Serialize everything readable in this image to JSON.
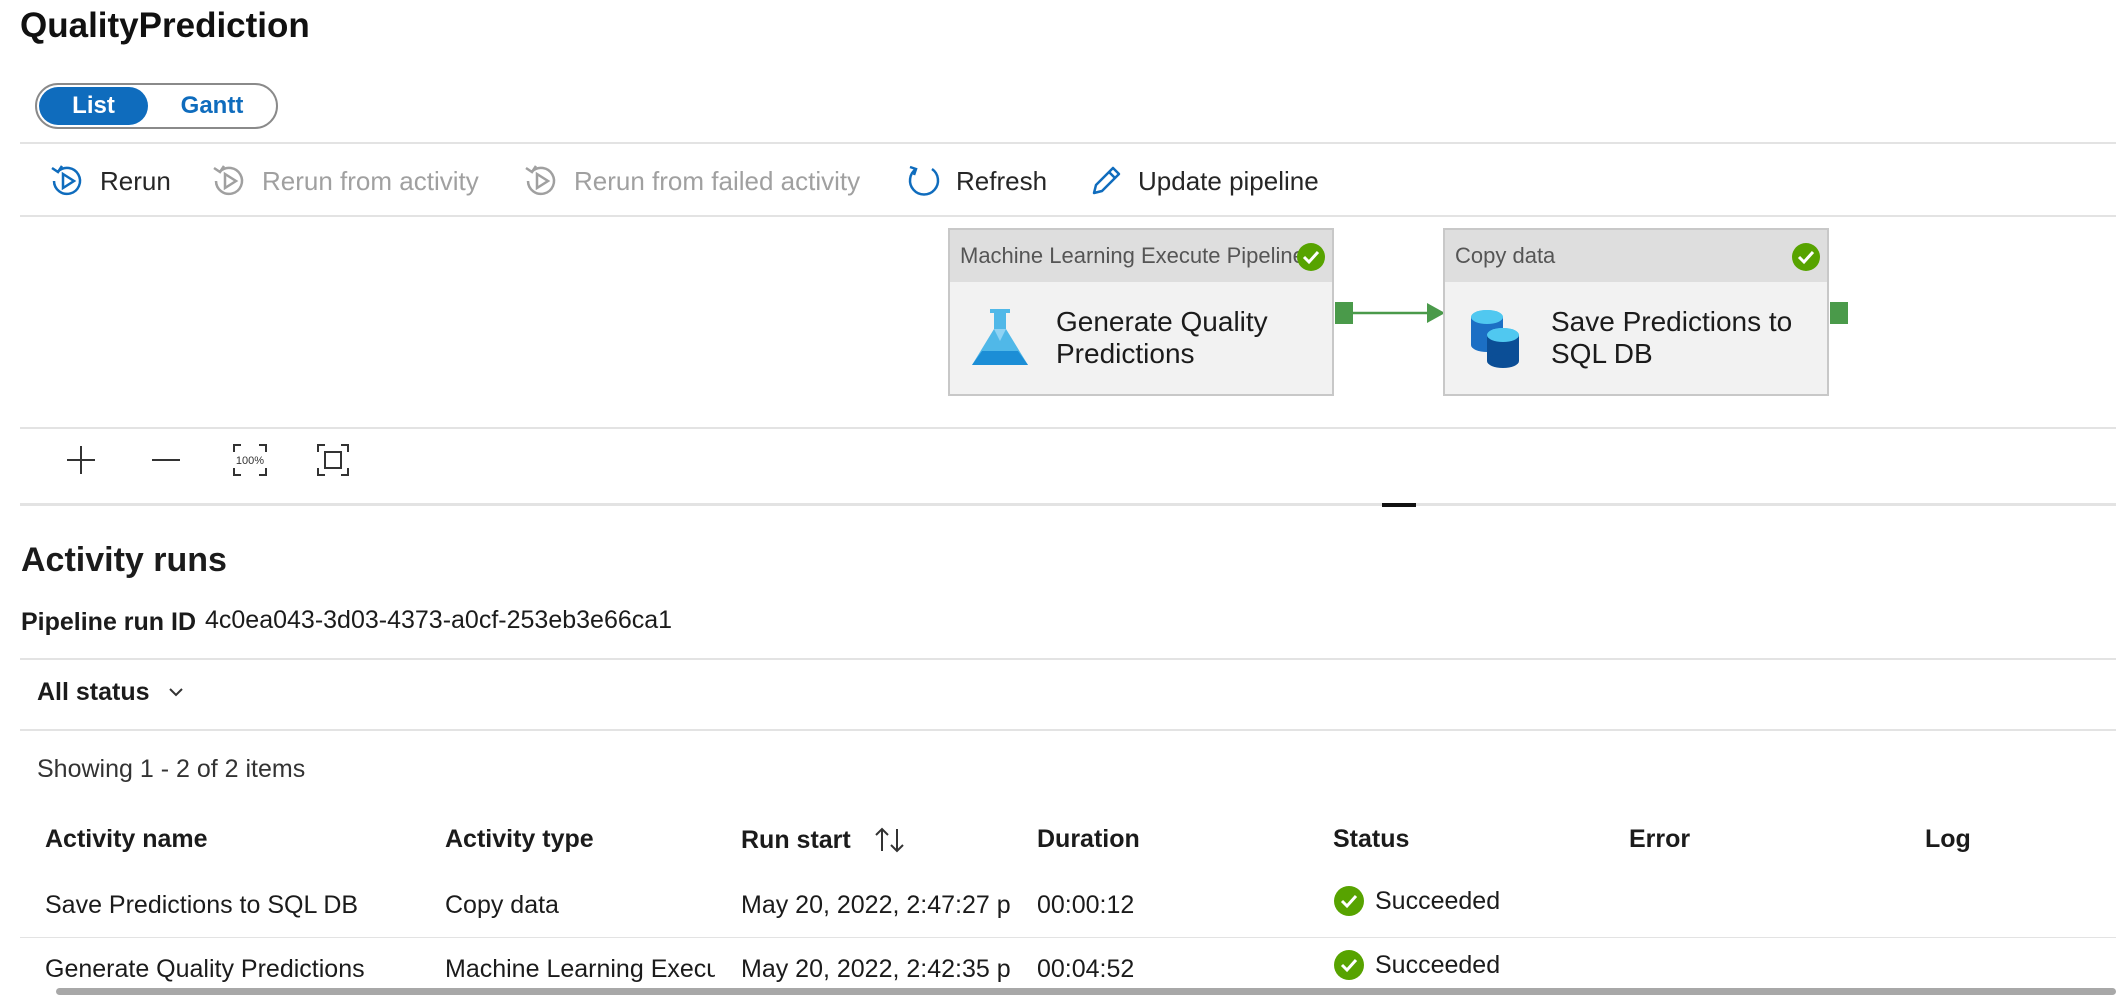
{
  "page_title": "QualityPrediction",
  "view_toggle": {
    "list_label": "List",
    "gantt_label": "Gantt",
    "selected": "List"
  },
  "toolbar": {
    "rerun": "Rerun",
    "rerun_from_activity": "Rerun from activity",
    "rerun_from_failed": "Rerun from failed activity",
    "refresh": "Refresh",
    "update_pipeline": "Update pipeline"
  },
  "canvas": {
    "nodes": [
      {
        "type_label": "Machine Learning Execute Pipeline",
        "name_line1": "Generate Quality",
        "name_line2": "Predictions",
        "icon": "flask-icon",
        "status": "succeeded"
      },
      {
        "type_label": "Copy data",
        "name_line1": "Save Predictions to",
        "name_line2": "SQL DB",
        "icon": "database-icon",
        "status": "succeeded"
      }
    ],
    "zoom_100_label": "100%"
  },
  "activity_runs": {
    "title": "Activity runs",
    "pipeline_run_id_label": "Pipeline run ID",
    "pipeline_run_id": "4c0ea043-3d03-4373-a0cf-253eb3e66ca1",
    "status_filter": "All status",
    "showing": "Showing 1 - 2 of 2 items",
    "columns": [
      "Activity name",
      "Activity type",
      "Run start",
      "Duration",
      "Status",
      "Error",
      "Log"
    ],
    "rows": [
      {
        "activity_name": "Save Predictions to SQL DB",
        "activity_type": "Copy data",
        "run_start": "May 20, 2022, 2:47:27 p",
        "duration": "00:00:12",
        "status": "Succeeded",
        "error": "",
        "log": ""
      },
      {
        "activity_name": "Generate Quality Predictions",
        "activity_type": "Machine Learning Execu",
        "run_start": "May 20, 2022, 2:42:35 p",
        "duration": "00:04:52",
        "status": "Succeeded",
        "error": "",
        "log": ""
      }
    ]
  },
  "colors": {
    "accent": "#0f6cbd",
    "success": "#57a300",
    "connector": "#4a9a4a"
  }
}
